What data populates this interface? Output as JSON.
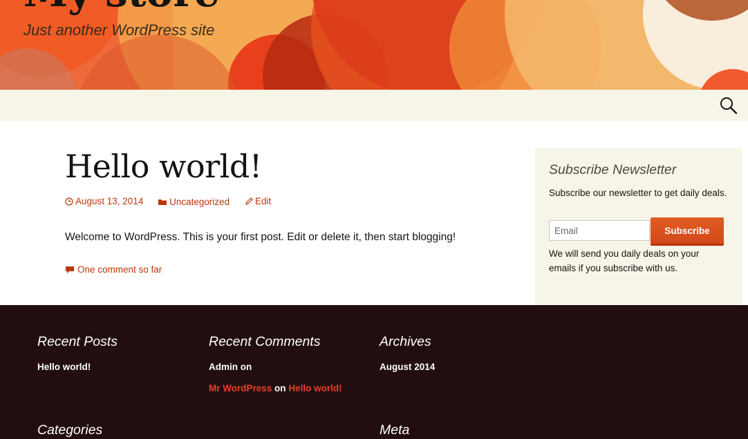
{
  "header": {
    "site_title": "My store",
    "site_description": "Just another WordPress site"
  },
  "nav": {
    "search_icon": "search-icon"
  },
  "post": {
    "title": "Hello world!",
    "date": "August 13, 2014",
    "category": "Uncategorized",
    "edit_label": "Edit",
    "content": "Welcome to WordPress. This is your first post. Edit or delete it, then start blogging!",
    "comments_link": "One comment so far"
  },
  "sidebar": {
    "newsletter_title": "Subscribe Newsletter",
    "newsletter_desc": "Subscribe our newsletter to get daily deals.",
    "email_placeholder": "Email",
    "subscribe_label": "Subscribe",
    "note": "We will send you daily deals on your emails if you subscribe with us."
  },
  "footer": {
    "recent_posts": {
      "title": "Recent Posts",
      "items": [
        "Hello world!"
      ]
    },
    "recent_comments": {
      "title": "Recent Comments",
      "items": [
        {
          "author": "Admin",
          "on": "on",
          "post": ""
        },
        {
          "author": "Mr WordPress",
          "on": "on",
          "post": "Hello world!"
        }
      ]
    },
    "archives": {
      "title": "Archives",
      "items": [
        "August 2014"
      ]
    },
    "categories": {
      "title": "Categories"
    },
    "meta": {
      "title": "Meta"
    }
  },
  "colors": {
    "accent": "#bc360a",
    "footer_bg": "#220e10",
    "footer_link": "#e63f2a",
    "navbar_bg": "#f7f5e7",
    "button": "#e05d22"
  }
}
